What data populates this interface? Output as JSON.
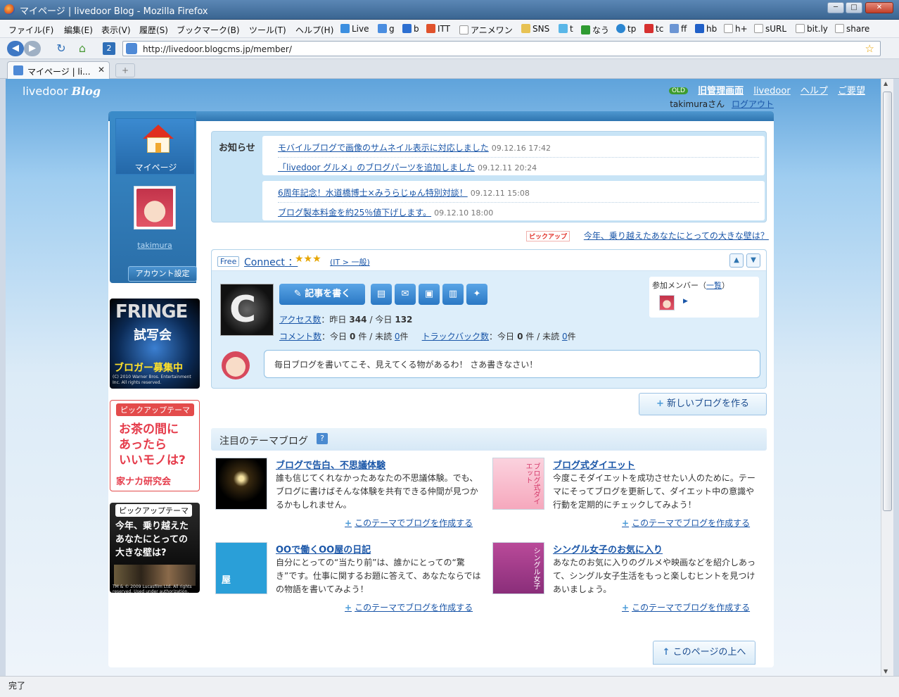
{
  "window": {
    "title": "マイページ | livedoor Blog - Mozilla Firefox",
    "min_label": "─",
    "max_label": "□",
    "close_label": "✕"
  },
  "menu": [
    "ファイル(F)",
    "編集(E)",
    "表示(V)",
    "履歴(S)",
    "ブックマーク(B)",
    "ツール(T)",
    "ヘルプ(H)"
  ],
  "bookmarks": [
    "Live",
    "g",
    "b",
    "ITT",
    "アニメワン",
    "SNS",
    "t",
    "なう",
    "tp",
    "tc",
    "ff",
    "hb",
    "h+",
    "sURL",
    "bit.ly",
    "share"
  ],
  "nav": {
    "url": "http://livedoor.blogcms.jp/member/",
    "back_icon": "◀",
    "forward_icon": "▶",
    "reload_icon": "↻",
    "home_icon": "⌂",
    "star_icon": "☆"
  },
  "tabs": [
    {
      "label": "マイページ | li..."
    }
  ],
  "tab_close": "✕",
  "tab_new": "+",
  "status": "完了",
  "site": {
    "logo_text": "livedoor",
    "logo_script": "Blog",
    "old_badge": "OLD",
    "old_admin": "旧管理画面",
    "link_livedoor": "livedoor",
    "link_help": "ヘルプ",
    "link_request": "ご要望",
    "user_name": "takimuraさん",
    "logout": "ログアウト"
  },
  "sidebar": {
    "mypage_label": "マイページ",
    "username": "takimura",
    "account_button": "アカウント設定"
  },
  "banners": {
    "fringe_title": "FRINGE",
    "fringe_sub": "試写会",
    "fringe_cta": "ブロガー募集中",
    "fringe_copy": "(C) 2010 Warner Bros. Entertainment Inc. All rights reserved.",
    "pickup1_head": "ピックアップテーマ",
    "pickup1_body": "お茶の間に\nあったら\nいいモノは?",
    "pickup1_foot": "家ナカ研究会",
    "pickup2_head": "ピックアップテーマ",
    "pickup2_body": "今年、乗り越えた\nあなたにとっての\n大きな壁は?",
    "pickup2_foot": "TM & © 2009 Lucasfilm Ltd. All rights reserved. Used under authorization."
  },
  "notice": {
    "label": "お知らせ",
    "items": [
      {
        "text": "モバイルブログで画像のサムネイル表示に対応しました",
        "date": "09.12.16 17:42"
      },
      {
        "text": "「livedoor グルメ」のブログパーツを追加しました",
        "date": "09.12.11 20:24"
      },
      {
        "text": "6周年記念！水道橋博士×みうらじゅん特別対談！",
        "date": "09.12.11 15:08"
      },
      {
        "text": "ブログ製本料金を約25％値下げします。",
        "date": "09.12.10 18:00"
      }
    ]
  },
  "pickup": {
    "badge": "ピックアップ",
    "link": "今年、乗り越えたあなたにとっての大きな壁は？"
  },
  "blog": {
    "free": "Free",
    "name": "Connect",
    "colon": "：",
    "stars": "★★★",
    "category": "(IT > 一般)",
    "icon_letter": "C",
    "write_button": "記事を書く",
    "write_icon": "✎",
    "tool_icons": [
      "▤",
      "✉",
      "▣",
      "▥",
      "✦"
    ],
    "access_label": "アクセス数",
    "access_yesterday_label": "：昨日",
    "access_yesterday": "344",
    "access_today_label": "/ 今日",
    "access_today": "132",
    "comment_label": "コメント数",
    "comment_today_label": "：今日",
    "comment_today": "0",
    "comment_unread_label": "件 / 未読",
    "comment_unread": "0",
    "trackback_label": "トラックバック数",
    "trackback_today_label": "：今日",
    "trackback_today": "0",
    "trackback_unread_label": "件 / 未読",
    "trackback_unread": "0",
    "ken": "件",
    "members_label": "参加メンバー（",
    "members_link": "一覧",
    "members_close": "）",
    "members_arrow": "▶",
    "bubble": "毎日ブログを書いてこそ、見えてくる物があるわ！ さあ書きなさい！",
    "up": "▲",
    "down": "▼"
  },
  "new_blog": {
    "icon": "+",
    "label": "新しいブログを作る"
  },
  "themes": {
    "heading": "注目のテーマブログ",
    "help": "?",
    "make_icon": "+",
    "items": [
      {
        "title": "ブログで告白、不思議体験",
        "desc": "誰も信じてくれなかったあなたの不思議体験。でも、ブログに書けばそんな体験を共有できる仲間が見つかるかもしれません。",
        "make": "このテーマでブログを作成する"
      },
      {
        "title": "ブログ式ダイエット",
        "desc": "今度こそダイエットを成功させたい人のために。テーマにそってブログを更新して、ダイエット中の意識や行動を定期的にチェックしてみよう！",
        "make": "このテーマでブログを作成する",
        "img_text": "ブログ式ダイエット"
      },
      {
        "title": "OOで働くOO屋の日記",
        "desc": "自分にとっての“当たり前”は、誰かにとっての“驚き”です。仕事に関するお題に答えて、あなたならではの物語を書いてみよう！",
        "make": "このテーマでブログを作成する",
        "img_text": "屋"
      },
      {
        "title": "シングル女子のお気に入り",
        "desc": "あなたのお気に入りのグルメや映画などを紹介しあって、シングル女子生活をもっと楽しむヒントを見つけあいましょう。",
        "make": "このテーマでブログを作成する",
        "img_text": "シングル女子"
      }
    ]
  },
  "page_top": {
    "icon": "↑",
    "label": "このページの上へ"
  }
}
